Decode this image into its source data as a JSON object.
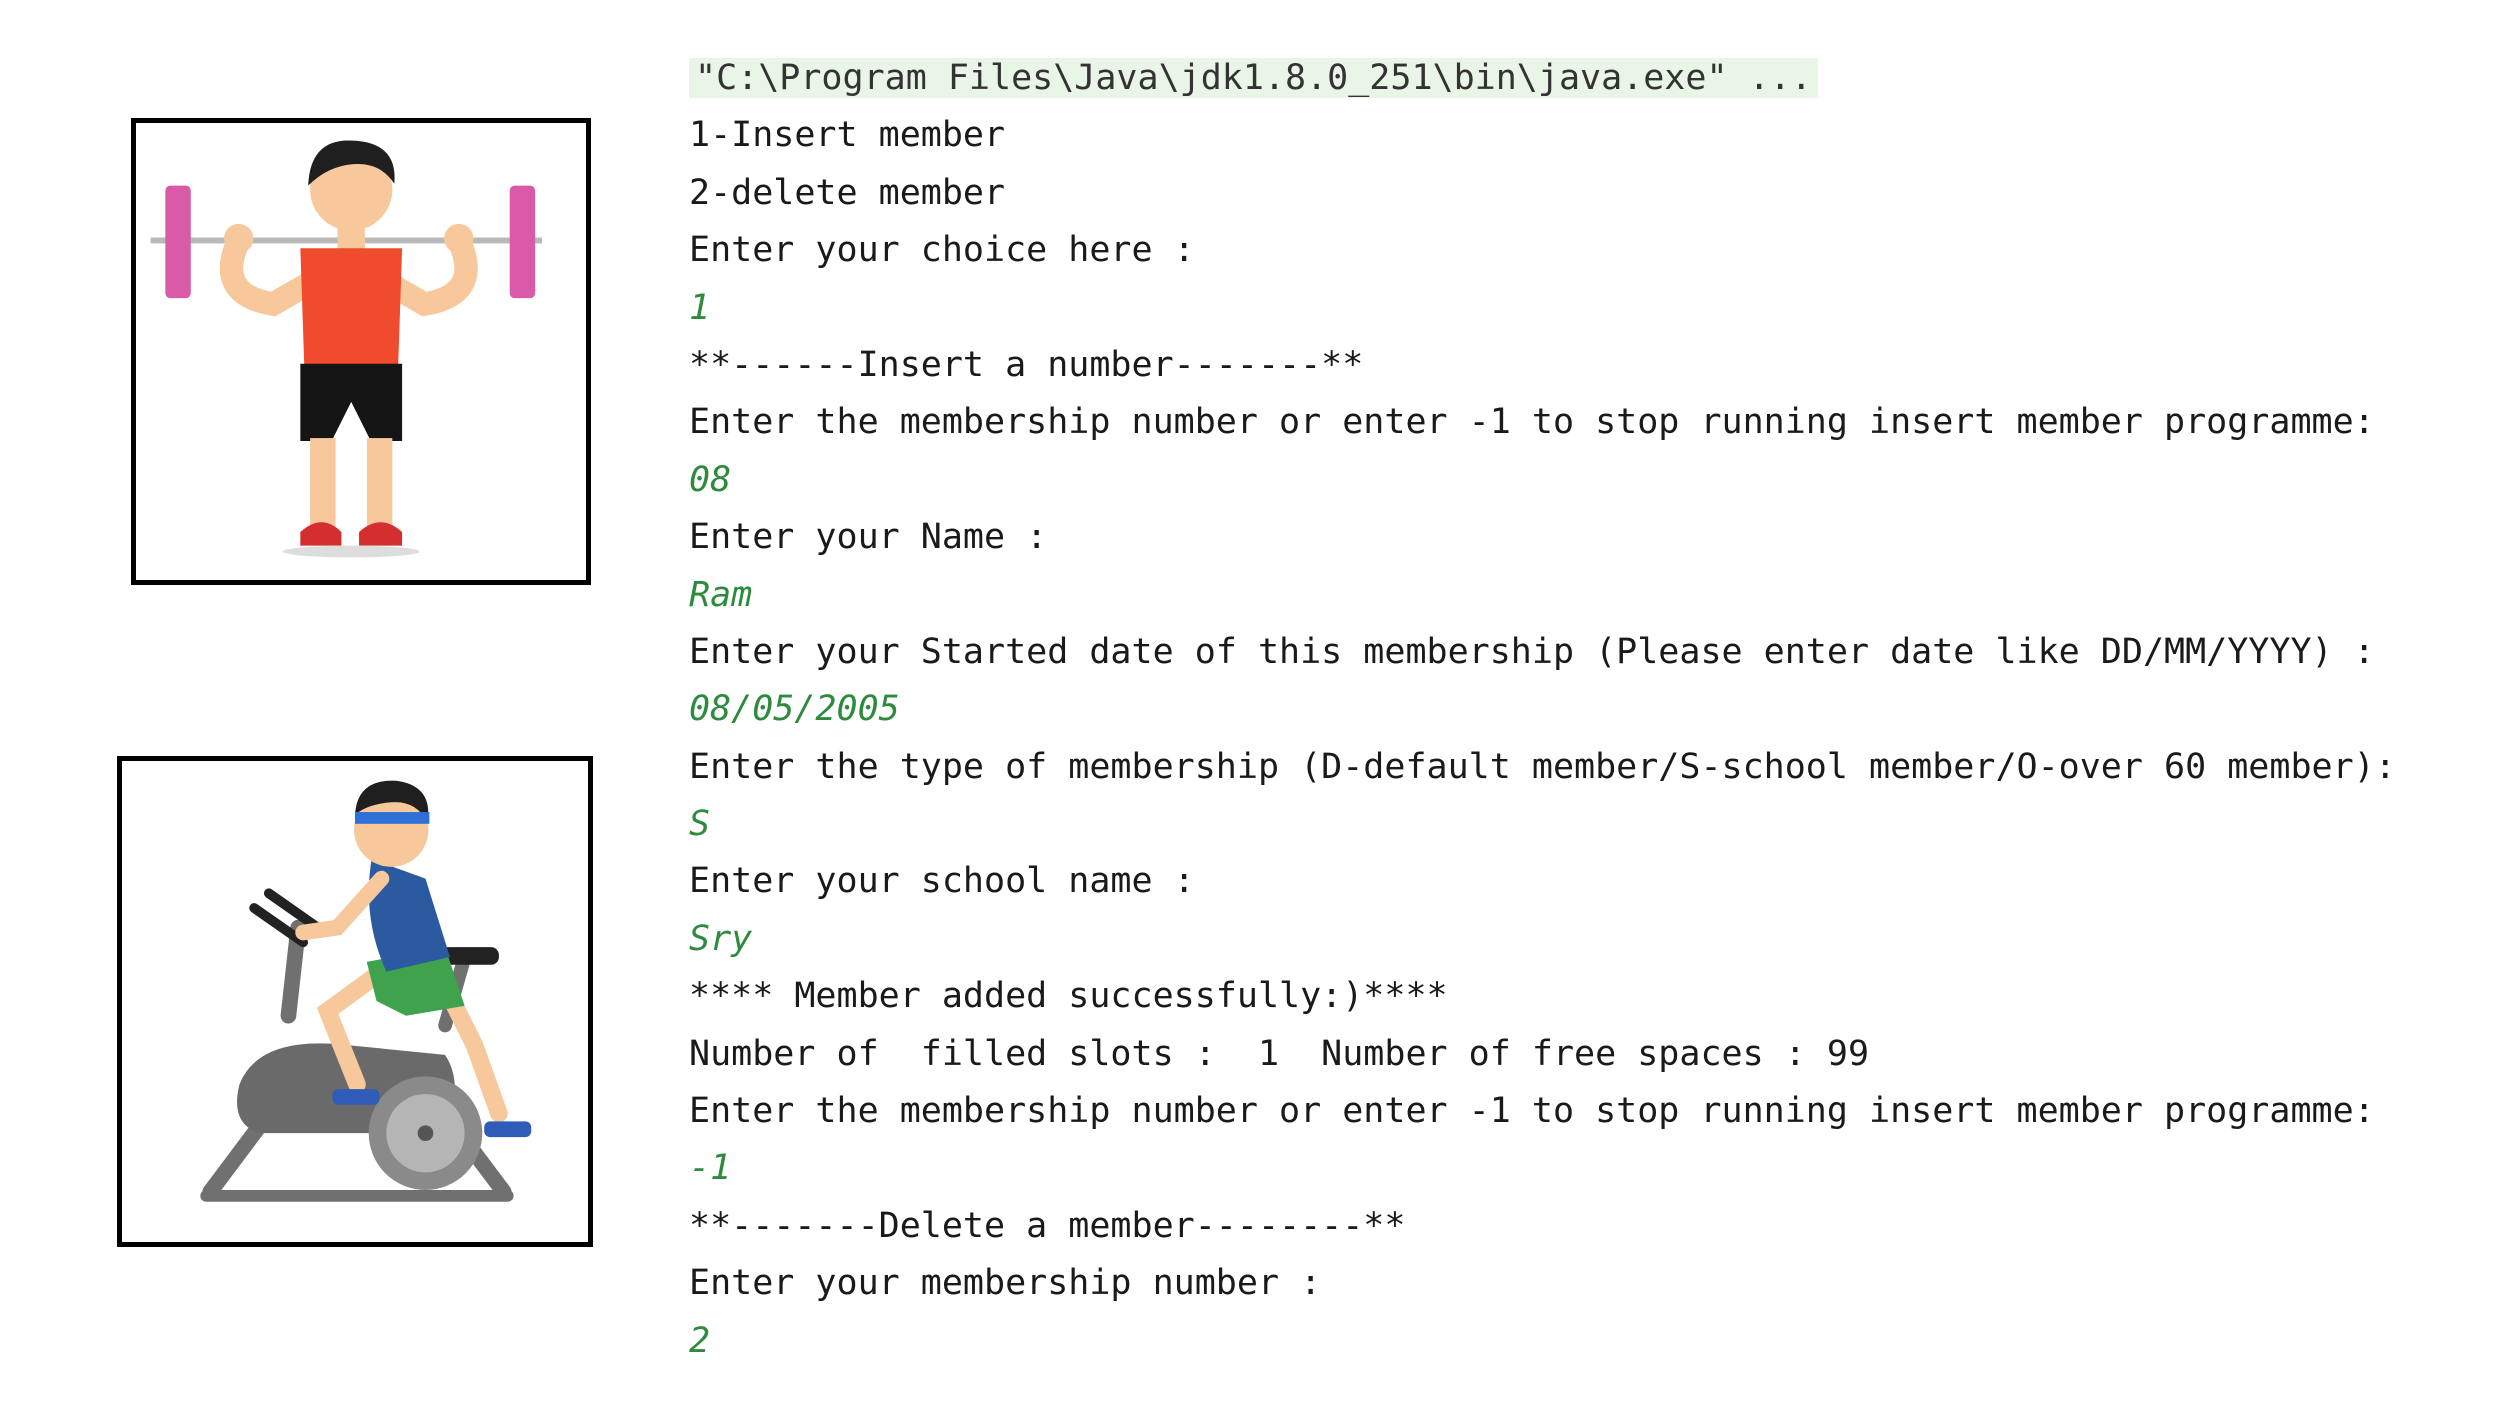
{
  "illustrations": {
    "weightlifter": "weightlifter-illustration",
    "cyclist": "exercise-bike-illustration"
  },
  "console": {
    "command": "\"C:\\Program Files\\Java\\jdk1.8.0_251\\bin\\java.exe\" ...",
    "lines": [
      {
        "text": "1-Insert member",
        "input": false
      },
      {
        "text": "2-delete member",
        "input": false
      },
      {
        "text": "Enter your choice here :",
        "input": false
      },
      {
        "text": "1",
        "input": true
      },
      {
        "text": "**------Insert a number-------**",
        "input": false
      },
      {
        "text": "Enter the membership number or enter -1 to stop running insert member programme:",
        "input": false
      },
      {
        "text": "08",
        "input": true
      },
      {
        "text": "Enter your Name :",
        "input": false
      },
      {
        "text": "Ram",
        "input": true
      },
      {
        "text": "Enter your Started date of this membership (Please enter date like DD/MM/YYYY) :",
        "input": false
      },
      {
        "text": "08/05/2005",
        "input": true
      },
      {
        "text": "Enter the type of membership (D-default member/S-school member/O-over 60 member):",
        "input": false
      },
      {
        "text": "S",
        "input": true
      },
      {
        "text": "Enter your school name :",
        "input": false
      },
      {
        "text": "Sry",
        "input": true
      },
      {
        "text": "**** Member added successfully:)****",
        "input": false
      },
      {
        "text": "Number of  filled slots :  1  Number of free spaces : 99",
        "input": false
      },
      {
        "text": "Enter the membership number or enter -1 to stop running insert member programme:",
        "input": false
      },
      {
        "text": "-1",
        "input": true
      },
      {
        "text": "**-------Delete a member--------**",
        "input": false
      },
      {
        "text": "Enter your membership number :",
        "input": false
      },
      {
        "text": "2",
        "input": true
      }
    ]
  },
  "colors": {
    "output_text": "#1a1a1a",
    "input_text": "#2e8b3e",
    "command_highlight": "#e9f5e6"
  }
}
